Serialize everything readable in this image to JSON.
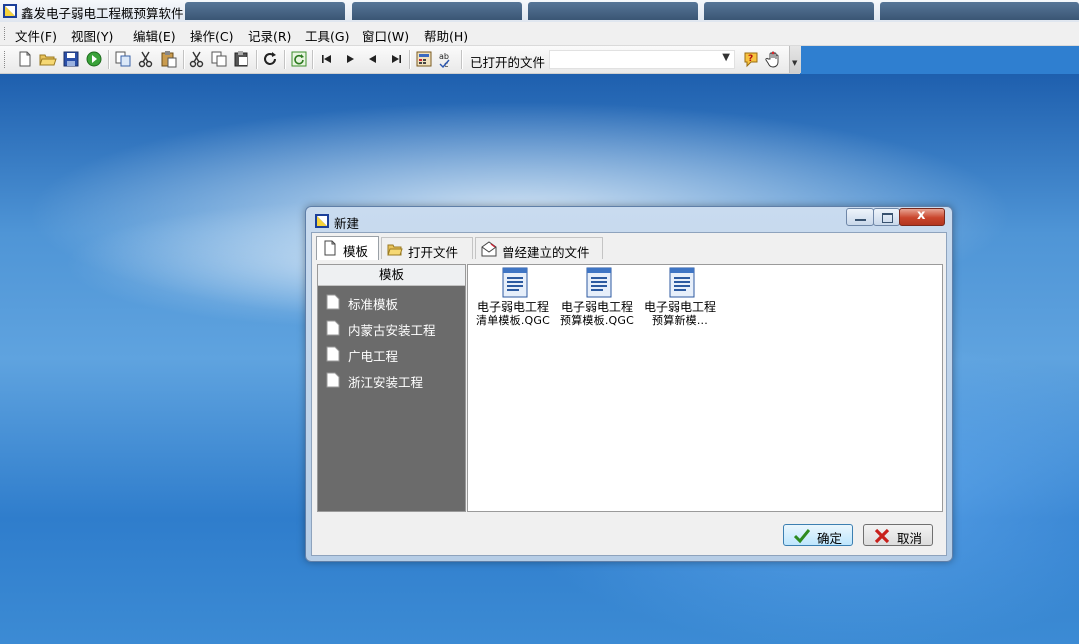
{
  "app": {
    "title": "鑫发电子弱电工程概预算软件"
  },
  "menu": {
    "items": [
      "文件(F)",
      "视图(Y)",
      "编辑(E)",
      "操作(C)",
      "记录(R)",
      "工具(G)",
      "窗口(W)",
      "帮助(H)"
    ]
  },
  "toolbar": {
    "open_files_label": "已打开的文件",
    "open_files_value": "",
    "icons": [
      "new-file-icon",
      "open-folder-icon",
      "save-icon",
      "run-icon",
      "copy-page-icon",
      "cut-icon",
      "paste-icon",
      "cut-icon-2",
      "copy-icon",
      "paste-icon-2",
      "redo-icon",
      "refresh-icon",
      "first-record-icon",
      "next-record-icon",
      "prev-record-icon",
      "last-record-icon",
      "calculator-icon",
      "spellcheck-icon",
      "help-icon",
      "hand-icon"
    ]
  },
  "dialog": {
    "title": "新建",
    "tabs": [
      {
        "label": "模板",
        "icon": "page-icon",
        "active": true
      },
      {
        "label": "打开文件",
        "icon": "open-folder-icon",
        "active": false
      },
      {
        "label": "曾经建立的文件",
        "icon": "history-file-icon",
        "active": false
      }
    ],
    "template_panel": {
      "header": "模板",
      "items": [
        "标准模板",
        "内蒙古安装工程",
        "广电工程",
        "浙江安装工程"
      ]
    },
    "files": [
      {
        "line1": "电子弱电工程",
        "line2": "清单模板.QGC"
      },
      {
        "line1": "电子弱电工程",
        "line2": "预算模板.QGC"
      },
      {
        "line1": "电子弱电工程",
        "line2": "预算新模..."
      }
    ],
    "buttons": {
      "ok": "确定",
      "cancel": "取消"
    }
  },
  "colors": {
    "left_panel_bg": "#6b6b6b",
    "ok_check": "#2e8b1f",
    "cancel_x": "#c8201b"
  }
}
